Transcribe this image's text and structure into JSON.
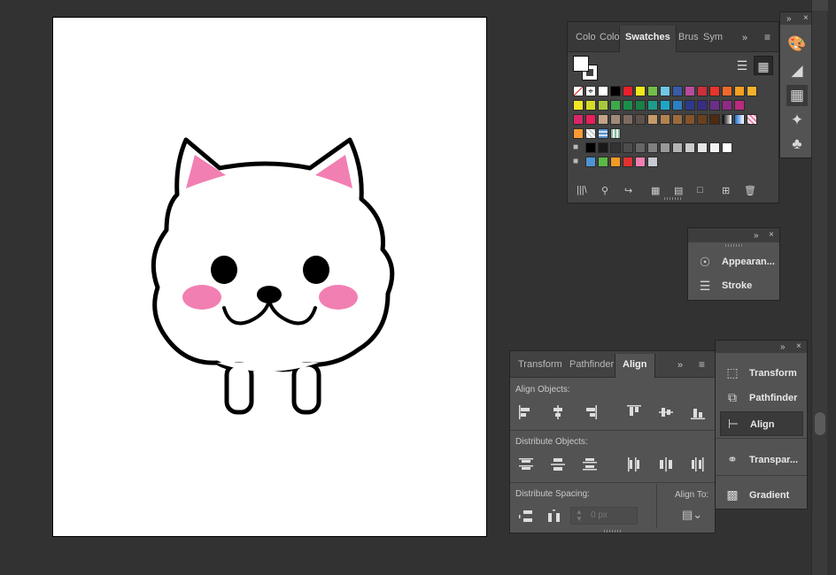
{
  "swatches_panel": {
    "tabs": [
      "Colo",
      "Colo",
      "Swatches",
      "Brus",
      "Sym"
    ],
    "active_tab": "Swatches",
    "rows": [
      [
        "#ffffff",
        "#ffffff",
        "#ffffff",
        "#000000",
        "#e8202a",
        "#f0e91b",
        "#72bd48",
        "#6fc7e6",
        "#3a5aa6",
        "#b64c9b",
        "#cc2f3b",
        "#e8342a",
        "#f0692a",
        "#f5a020",
        "#f6b02c"
      ],
      [
        "#f2e523",
        "#d5db26",
        "#a7c640",
        "#3fa94a",
        "#1a8f49",
        "#1b7f46",
        "#1e9d8b",
        "#1fa6c4",
        "#2d7fc2",
        "#2c3a8c",
        "#392d83",
        "#6b2e8a",
        "#8d2a85",
        "#ba2a7e"
      ],
      [
        "#d8266b",
        "#e71f5a",
        "#c4a488",
        "#a08a7a",
        "#7d6b60",
        "#5e514a",
        "#c79a6a",
        "#b2834f",
        "#9b6b3d",
        "#845428",
        "#6a3f1d",
        "#4d2a12"
      ],
      [
        "#ff9933"
      ],
      [
        "#000000",
        "#1a1a1a",
        "#333333",
        "#4d4d4d",
        "#666666",
        "#808080",
        "#999999",
        "#b3b3b3",
        "#cccccc",
        "#e6e6e6",
        "#f2f2f2",
        "#ffffff"
      ],
      [
        "#4e93d3",
        "#5ab947",
        "#f19a26",
        "#e03231",
        "#ef7fb0",
        "#c6cbd3"
      ]
    ]
  },
  "icon_strip": {
    "items": [
      "palette-icon",
      "gradient-arc-icon",
      "swatch-grid-icon",
      "brush-icon",
      "club-icon"
    ],
    "active": "swatch-grid-icon"
  },
  "appearance_panel": {
    "items": [
      {
        "label": "Appearan...",
        "icon": "appearance-icon"
      },
      {
        "label": "Stroke",
        "icon": "stroke-lines-icon"
      }
    ]
  },
  "align_panel": {
    "tabs": [
      "Transform",
      "Pathfinder",
      "Align"
    ],
    "active_tab": "Align",
    "sections": {
      "align_objects": "Align Objects:",
      "distribute_objects": "Distribute Objects:",
      "distribute_spacing": "Distribute Spacing:",
      "align_to": "Align To:"
    },
    "spacing_value": "0 px"
  },
  "list_panel": {
    "items": [
      {
        "label": "Transform",
        "icon": "transform-icon"
      },
      {
        "label": "Pathfinder",
        "icon": "pathfinder-icon"
      },
      {
        "label": "Align",
        "icon": "align-icon"
      },
      {
        "label": "Transpar...",
        "icon": "transparency-icon"
      },
      {
        "label": "Gradient",
        "icon": "gradient-icon"
      }
    ],
    "active": "Align"
  },
  "artboard": {
    "background": "#ffffff",
    "subject": "cartoon white dog",
    "colors": {
      "outline": "#000000",
      "ear": "#f27fb2",
      "cheek": "#f27fb2"
    }
  }
}
